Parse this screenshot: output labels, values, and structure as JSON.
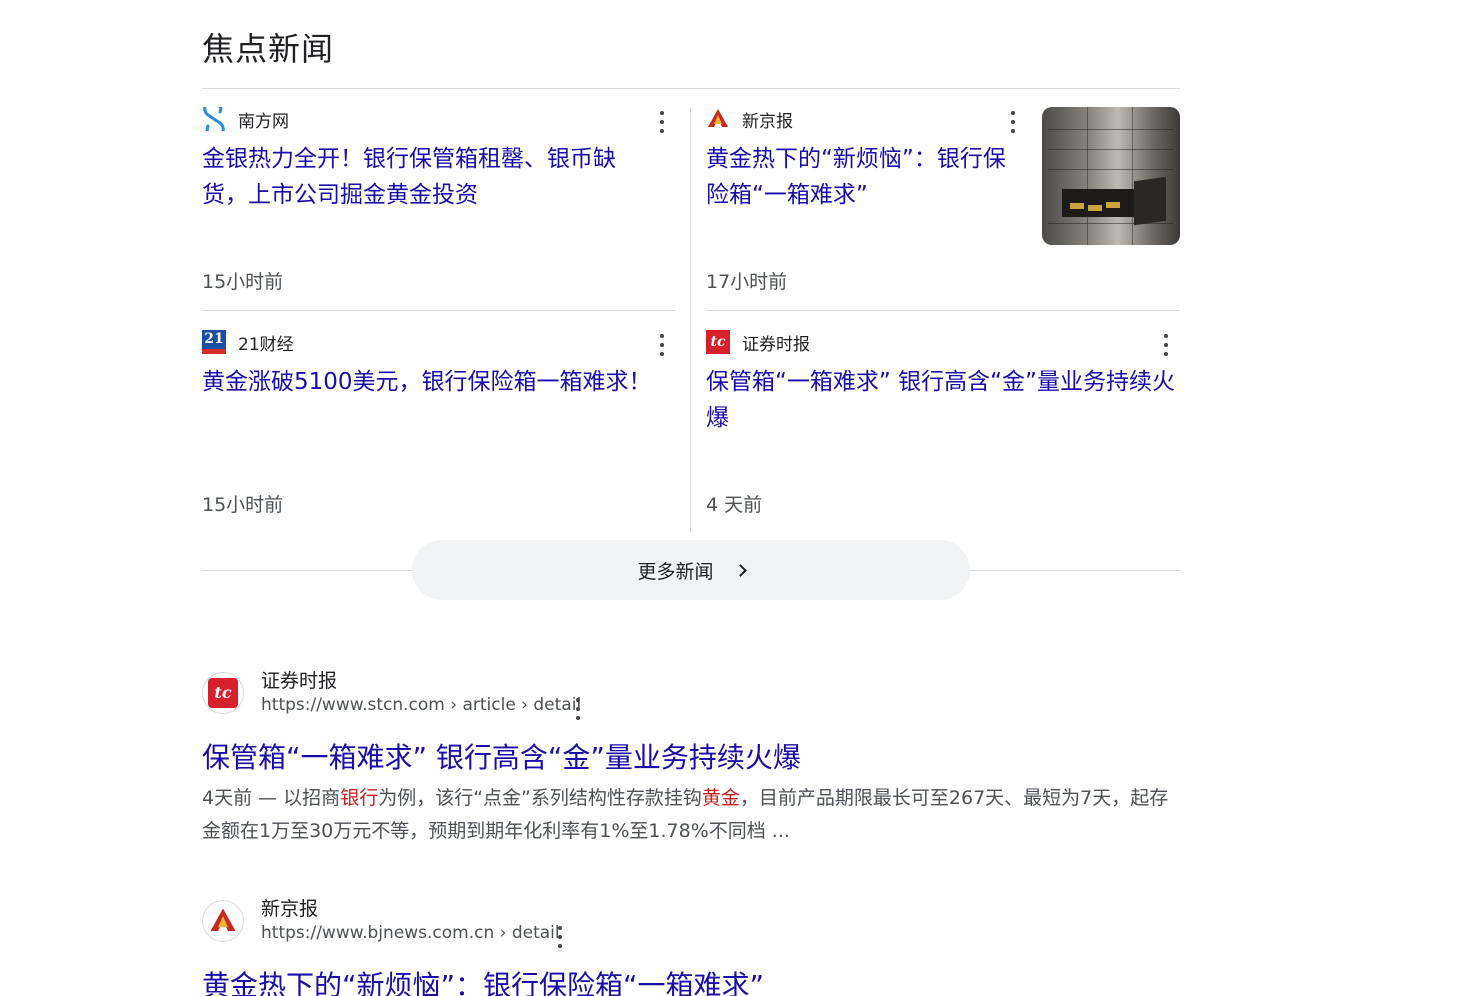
{
  "section": {
    "title": "焦点新闻",
    "more_label": "更多新闻"
  },
  "cards": [
    {
      "source": "南方网",
      "headline": "金银热力全开！银行保管箱租罄、银币缺货，上市公司掘金黄金投资",
      "time": "15小时前"
    },
    {
      "source": "新京报",
      "headline": "黄金热下的“新烦恼”：银行保险箱“一箱难求”",
      "time": "17小时前"
    },
    {
      "source": "21财经",
      "headline": "黄金涨破5100美元，银行保险箱一箱难求！",
      "time": "15小时前"
    },
    {
      "source": "证券时报",
      "headline": "保管箱“一箱难求” 银行高含“金”量业务持续火爆",
      "time": "4 天前"
    }
  ],
  "results": [
    {
      "site": "证券时报",
      "url": "https://www.stcn.com › article › detail",
      "title": "保管箱“一箱难求” 银行高含“金”量业务持续火爆",
      "snippet_date": "4天前 — ",
      "snippet_a": "以招商",
      "snippet_hl1": "银行",
      "snippet_b": "为例，该行“点金”系列结构性存款挂钩",
      "snippet_hl2": "黄金",
      "snippet_c": "，目前产品期限最长可至267天、最短为7天，起存金额在1万至30万元不等，预期到期年化利率有1%至1.78%不同档 ..."
    },
    {
      "site": "新京报",
      "url": "https://www.bjnews.com.cn › detail",
      "title": "黄金热下的“新烦恼”：银行保险箱“一箱难求”"
    }
  ],
  "icons": {
    "card_menu": "more-vert-icon",
    "more_news": "chevron-right-icon",
    "nanfang_logo": "nanfang-logo-icon",
    "bjnews_logo": "bjnews-logo-icon",
    "cj21_logo": "21cj-logo-icon",
    "stcn_logo": "stcn-logo-icon"
  },
  "colors": {
    "link": "#1a0dab",
    "highlight": "#c5221f",
    "text_secondary": "#4d5156"
  }
}
